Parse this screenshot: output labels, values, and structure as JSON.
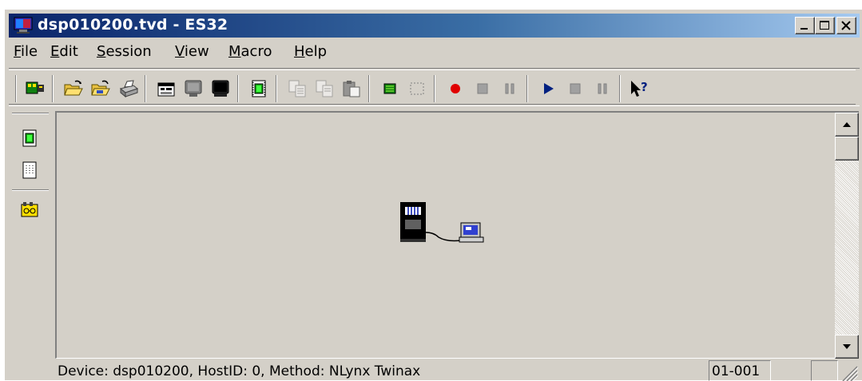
{
  "window": {
    "title": "dsp010200.tvd - ES32"
  },
  "menu": [
    {
      "label": "File",
      "u": "F",
      "rest": "ile"
    },
    {
      "label": "Edit",
      "u": "E",
      "rest": "dit"
    },
    {
      "label": "Session",
      "u": "S",
      "rest": "ession"
    },
    {
      "label": "View",
      "u": "V",
      "rest": "iew"
    },
    {
      "label": "Macro",
      "u": "M",
      "rest": "acro"
    },
    {
      "label": "Help",
      "u": "H",
      "rest": "elp"
    }
  ],
  "toolbar": {
    "buttons": [
      "device-icon",
      "open-folder-icon",
      "open-folder-alt-icon",
      "print-icon",
      "properties-icon",
      "terminal-off-icon",
      "terminal-icon",
      "capture-icon",
      "copy-icon",
      "copy-alt-icon",
      "paste-icon",
      "table-icon",
      "select-icon",
      "record-icon",
      "stop-icon",
      "pause-icon",
      "play-icon",
      "stop-play-icon",
      "pause-play-icon",
      "context-help-icon"
    ]
  },
  "vtoolbar": {
    "buttons": [
      "capture-icon",
      "dots-icon",
      "network-icon"
    ]
  },
  "status": {
    "text": "Device: dsp010200, HostID: 0, Method: NLynx Twinax",
    "code": "01-001"
  },
  "colors": {
    "titlebar_start": "#0a246a",
    "titlebar_end": "#a6caf0",
    "face": "#d4d0c8"
  }
}
